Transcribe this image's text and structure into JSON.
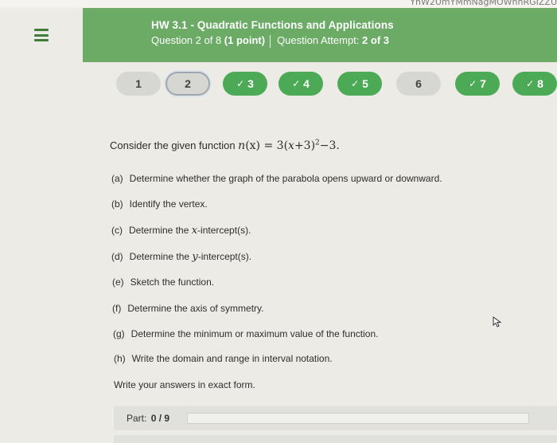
{
  "header": {
    "top_strip_text": "YnW2UmYMmNagMOWnnRGIZZU",
    "hw_title": "HW 3.1 - Quadratic Functions and Applications",
    "question_prefix": "Question 2 of 8",
    "points": "(1 point)",
    "attempt_prefix": "Question Attempt:",
    "attempt_value": "2 of 3"
  },
  "question_nav": [
    {
      "label": "1",
      "state": "plain",
      "check": ""
    },
    {
      "label": "2",
      "state": "current",
      "check": ""
    },
    {
      "label": "3",
      "state": "done",
      "check": "✓"
    },
    {
      "label": "4",
      "state": "done",
      "check": "✓"
    },
    {
      "label": "5",
      "state": "done",
      "check": "✓"
    },
    {
      "label": "6",
      "state": "plain",
      "check": ""
    },
    {
      "label": "7",
      "state": "done",
      "check": "✓"
    },
    {
      "label": "8",
      "state": "done",
      "check": "✓"
    }
  ],
  "problem": {
    "intro_prefix": "Consider the given function",
    "function_name": "n",
    "function_arg": "(x)",
    "function_rhs_a": " = 3(",
    "function_var": "x",
    "function_rhs_b": "+3)",
    "function_exp": "2",
    "function_rhs_c": "−3.",
    "parts": [
      {
        "label": "(a)",
        "pre": "Determine whether the graph of the parabola opens upward or downward.",
        "var": "",
        "post": ""
      },
      {
        "label": "(b)",
        "pre": "Identify the vertex.",
        "var": "",
        "post": ""
      },
      {
        "label": "(c)",
        "pre": "Determine the ",
        "var": "x",
        "post": "-intercept(s)."
      },
      {
        "label": "(d)",
        "pre": "Determine the ",
        "var": "y",
        "post": "-intercept(s)."
      },
      {
        "label": "(e)",
        "pre": "Sketch the function.",
        "var": "",
        "post": ""
      },
      {
        "label": "(f)",
        "pre": "Determine the axis of symmetry.",
        "var": "",
        "post": ""
      },
      {
        "label": "(g)",
        "pre": "Determine the minimum or maximum value of the function.",
        "var": "",
        "post": ""
      },
      {
        "label": "(h)",
        "pre": "Write the domain and range in interval notation.",
        "var": "",
        "post": ""
      }
    ],
    "answer_note": "Write your answers in exact form."
  },
  "part_progress": {
    "label": "Part:",
    "value": "0 / 9",
    "fraction": 0
  },
  "colors": {
    "header_green": "#6bab66",
    "done_green": "#4caa56",
    "pill_gray": "#d6d6d3"
  }
}
